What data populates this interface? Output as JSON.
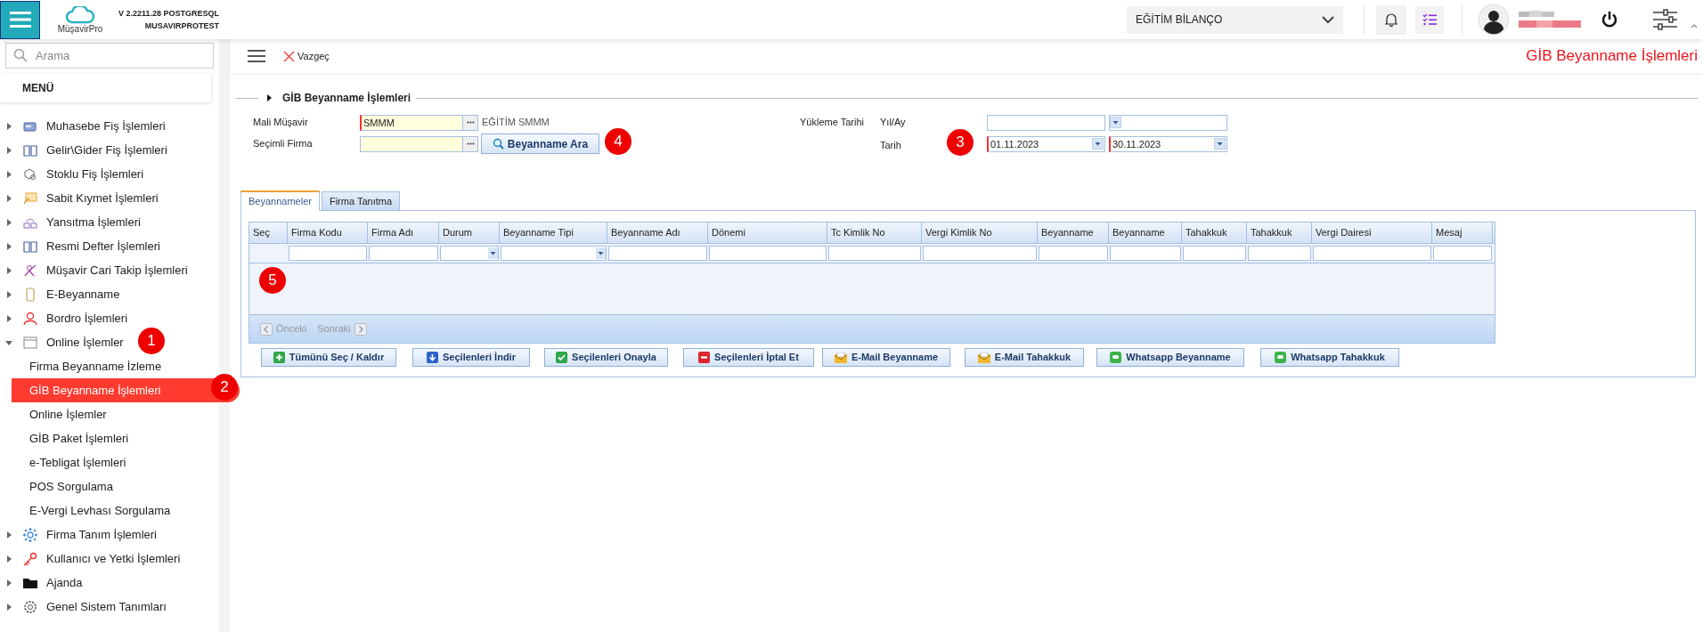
{
  "topbar": {
    "logo_text": "MüşavirPro",
    "version": "V 2.2211.28 POSTGRESQL",
    "database": "MUSAVIRPROTEST",
    "company": "EĞİTİM BİLANÇO"
  },
  "sidebar": {
    "search_placeholder": "Arama",
    "menu_title": "MENÜ",
    "items": [
      {
        "label": "Muhasebe Fiş İşlemleri",
        "expanded": false
      },
      {
        "label": "Gelir\\Gider Fiş İşlemleri",
        "expanded": false
      },
      {
        "label": "Stoklu Fiş İşlemleri",
        "expanded": false
      },
      {
        "label": "Sabit Kıymet İşlemleri",
        "expanded": false
      },
      {
        "label": "Yansıtma İşlemleri",
        "expanded": false
      },
      {
        "label": "Resmi Defter İşlemleri",
        "expanded": false
      },
      {
        "label": "Müşavir Cari Takip İşlemleri",
        "expanded": false
      },
      {
        "label": "E-Beyanname",
        "expanded": false
      },
      {
        "label": "Bordro İşlemleri",
        "expanded": false
      },
      {
        "label": "Online İşlemler",
        "expanded": true,
        "children": [
          {
            "label": "Firma Beyanname İzleme",
            "selected": false
          },
          {
            "label": "GİB Beyanname İşlemleri",
            "selected": true
          },
          {
            "label": "Online İşlemler",
            "selected": false
          },
          {
            "label": "GİB Paket İşlemleri",
            "selected": false
          },
          {
            "label": "e-Tebligat İşlemleri",
            "selected": false
          },
          {
            "label": "POS Sorgulama",
            "selected": false
          },
          {
            "label": "E-Vergi Levhası Sorgulama",
            "selected": false
          }
        ]
      },
      {
        "label": "Firma Tanım İşlemleri",
        "expanded": false
      },
      {
        "label": "Kullanıcı ve Yetki İşlemleri",
        "expanded": false
      },
      {
        "label": "Ajanda",
        "expanded": false
      },
      {
        "label": "Genel Sistem Tanımları",
        "expanded": false
      }
    ]
  },
  "toolbar": {
    "cancel": "Vazgeç",
    "page_title": "GİB Beyanname İşlemleri"
  },
  "form": {
    "legend": "GİB Beyanname İşlemleri",
    "mali_musavir": {
      "label": "Mali Müşavir",
      "value": "SMMM",
      "required": true,
      "description": "EĞİTİM SMMM"
    },
    "secimli_firma": {
      "label": "Seçimli Firma",
      "required": false
    },
    "search_button": "Beyanname Ara",
    "upload_label": "Yükleme Tarihi",
    "year_month_label": "Yıl/Ay",
    "date_label": "Tarih",
    "date_from": {
      "value": "01.11.2023",
      "required": true
    },
    "date_to": {
      "value": "30.11.2023",
      "required": true
    }
  },
  "tabs": [
    {
      "label": "Beyannameler",
      "selected": true
    },
    {
      "label": "Firma Tanıtma",
      "selected": false
    }
  ],
  "grid": {
    "columns": [
      {
        "label": "Seç",
        "kind": "plain"
      },
      {
        "label": "Firma Kodu",
        "kind": "text"
      },
      {
        "label": "Firma Adı",
        "kind": "text"
      },
      {
        "label": "Durum",
        "kind": "select"
      },
      {
        "label": "Beyanname Tipi",
        "kind": "select"
      },
      {
        "label": "Beyanname Adı",
        "kind": "text"
      },
      {
        "label": "Dönemi",
        "kind": "text"
      },
      {
        "label": "Tc Kimlik No",
        "kind": "text"
      },
      {
        "label": "Vergi Kimlik No",
        "kind": "text"
      },
      {
        "label": "Beyanname",
        "kind": "text"
      },
      {
        "label": "Beyanname",
        "kind": "text"
      },
      {
        "label": "Tahakkuk",
        "kind": "text"
      },
      {
        "label": "Tahakkuk",
        "kind": "text"
      },
      {
        "label": "Vergi Dairesi",
        "kind": "text"
      },
      {
        "label": "Mesaj",
        "kind": "text"
      }
    ],
    "pager": {
      "previous": "Önceki",
      "next": "Sonraki",
      "disabled": true
    }
  },
  "actions": [
    {
      "label": "Tümünü Seç / Kaldır",
      "kind": "add"
    },
    {
      "label": "Seçilenleri İndir",
      "kind": "download"
    },
    {
      "label": "Seçilenleri Onayla",
      "kind": "approve"
    },
    {
      "label": "Seçilenleri İptal Et",
      "kind": "cancel"
    },
    {
      "label": "E-Mail Beyanname",
      "kind": "email"
    },
    {
      "label": "E-Mail Tahakkuk",
      "kind": "email"
    },
    {
      "label": "Whatsapp Beyanname",
      "kind": "whatsapp"
    },
    {
      "label": "Whatsapp Tahakkuk",
      "kind": "whatsapp"
    }
  ],
  "annotations": [
    "1",
    "2",
    "3",
    "4",
    "5"
  ]
}
